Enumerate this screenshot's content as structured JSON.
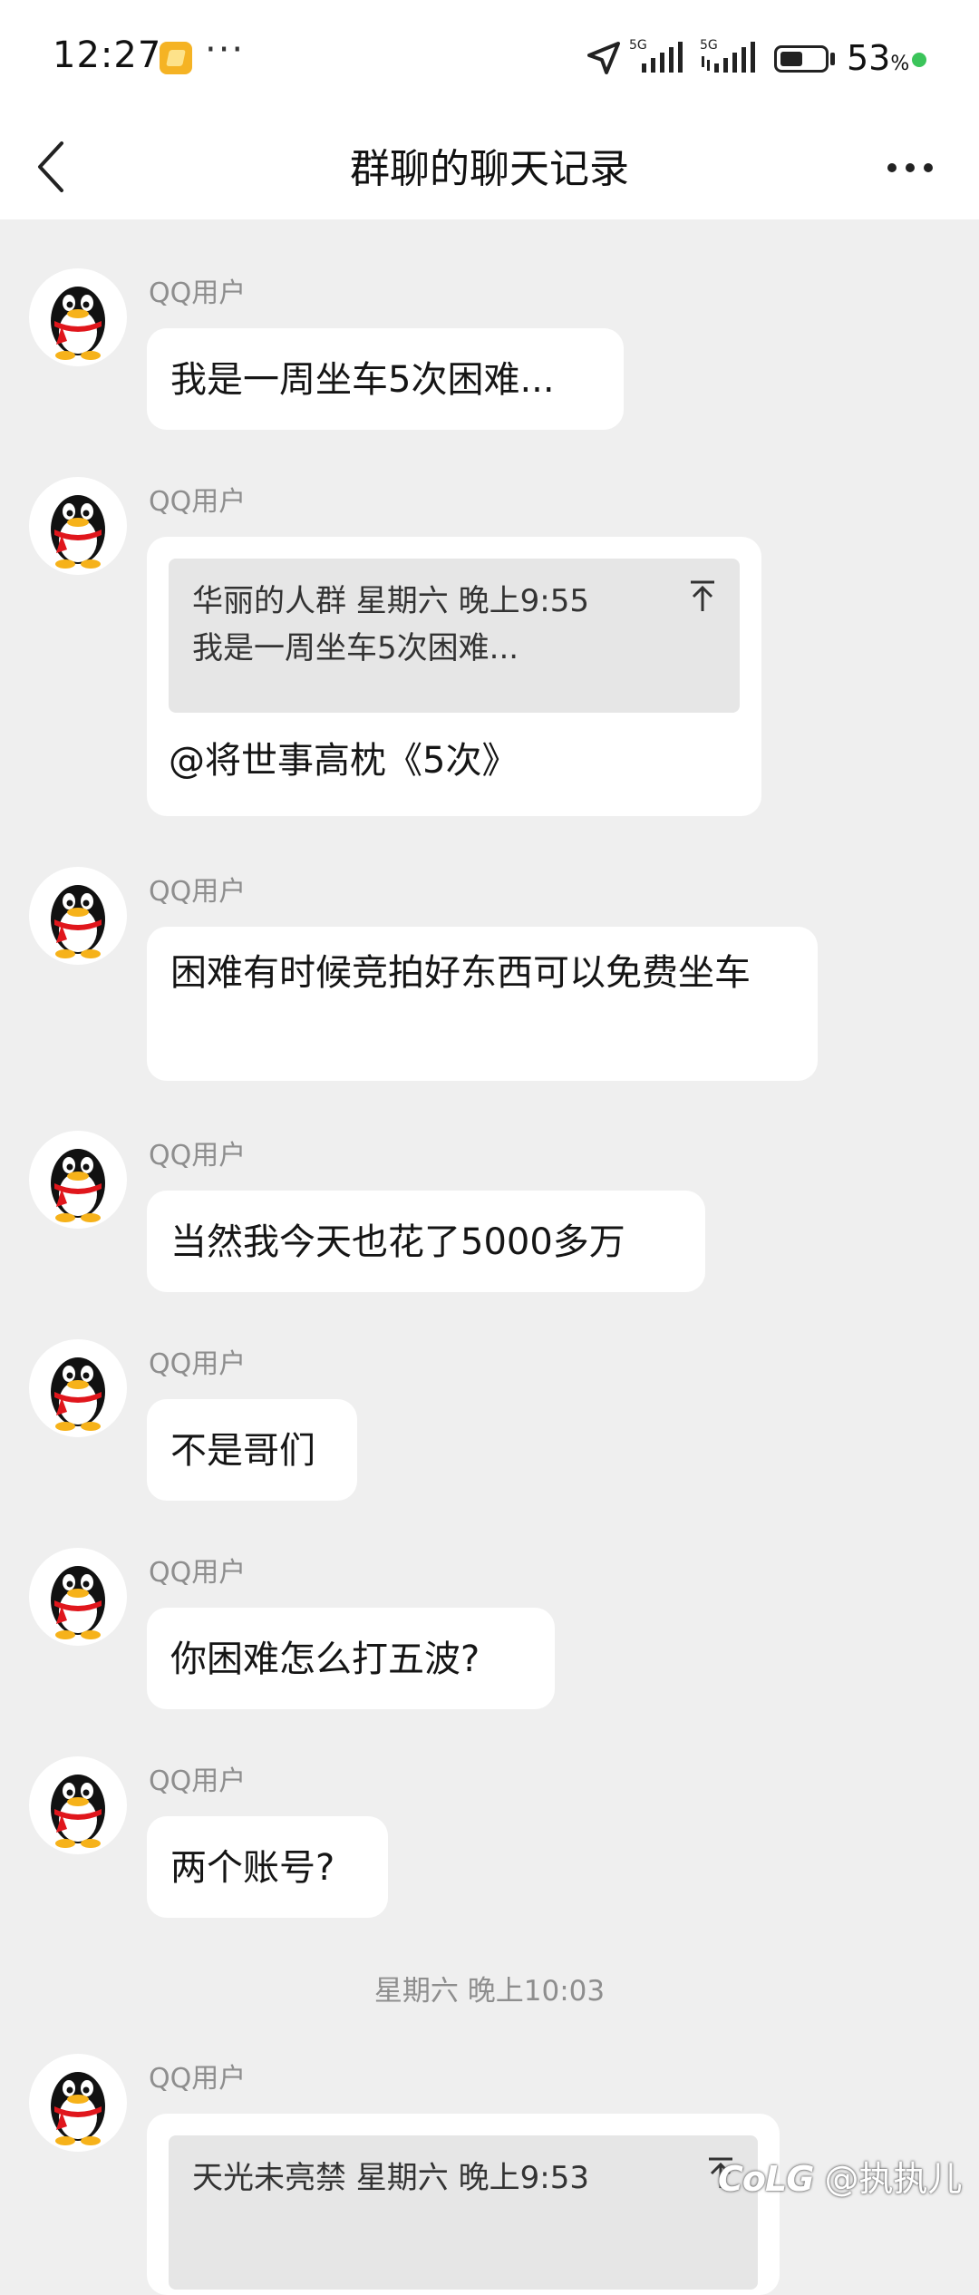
{
  "status_bar": {
    "time": "12:27",
    "dots": "···",
    "network1": "5G",
    "network2": "5G",
    "battery_percent": 53,
    "battery_text": "53",
    "percent_sign": "%"
  },
  "navbar": {
    "title": "群聊的聊天记录",
    "back_icon": "chevron-left-icon",
    "more_icon": "more-horizontal-icon"
  },
  "messages": [
    {
      "sender": "QQ用户",
      "text": "我是一周坐车5次困难..."
    },
    {
      "sender": "QQ用户",
      "quote": {
        "header": "华丽的人群  星期六 晚上9:55",
        "text": "我是一周坐车5次困难..."
      },
      "text": "@将世事高枕《5次》"
    },
    {
      "sender": "QQ用户",
      "text": "困难有时候竞拍好东西可以免费坐车"
    },
    {
      "sender": "QQ用户",
      "text": "当然我今天也花了5000多万"
    },
    {
      "sender": "QQ用户",
      "text": "不是哥们"
    },
    {
      "sender": "QQ用户",
      "text": "你困难怎么打五波?"
    },
    {
      "sender": "QQ用户",
      "text": "两个账号?"
    },
    {
      "sender": "QQ用户",
      "quote": {
        "header": "天光未亮禁  星期六 晚上9:53"
      }
    }
  ],
  "time_separator": "星期六 晚上10:03",
  "watermark": {
    "logo": "CoLG",
    "text": "@执执儿"
  },
  "colors": {
    "background": "#efefef",
    "bubble": "#ffffff",
    "quote": "#e6e6e6",
    "secondary_text": "#8e8e8e"
  }
}
